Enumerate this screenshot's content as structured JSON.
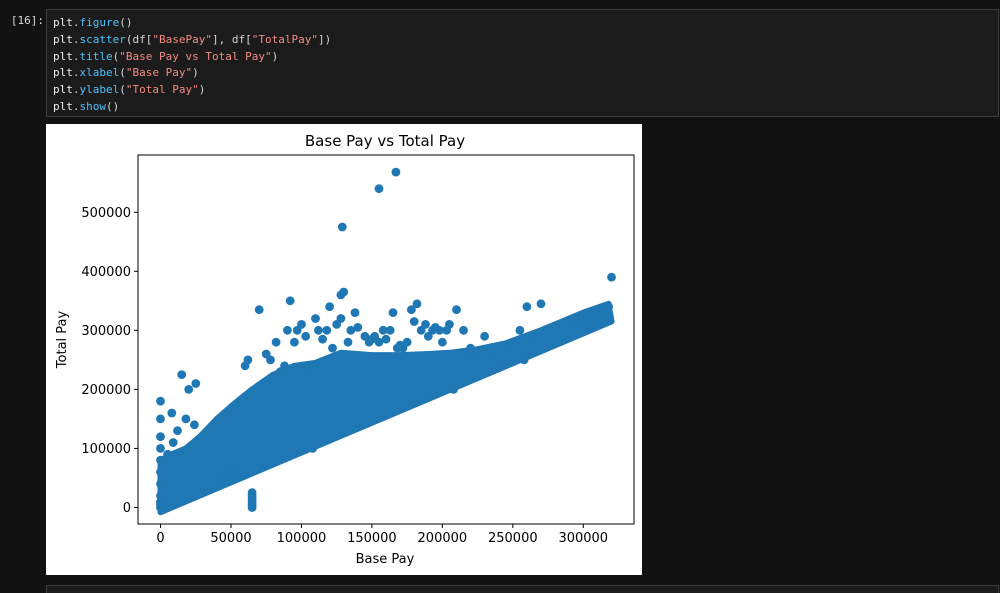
{
  "cell": {
    "prompt": "[16]:",
    "code_lines": [
      [
        {
          "t": "plt",
          "c": "plt"
        },
        {
          "t": ".",
          "c": "punct"
        },
        {
          "t": "figure",
          "c": "fn"
        },
        {
          "t": "()",
          "c": "punct"
        }
      ],
      [
        {
          "t": "plt",
          "c": "plt"
        },
        {
          "t": ".",
          "c": "punct"
        },
        {
          "t": "scatter",
          "c": "fn"
        },
        {
          "t": "(df[",
          "c": "punct"
        },
        {
          "t": "\"BasePay\"",
          "c": "str"
        },
        {
          "t": "], df[",
          "c": "punct"
        },
        {
          "t": "\"TotalPay\"",
          "c": "str"
        },
        {
          "t": "])",
          "c": "punct"
        }
      ],
      [
        {
          "t": "plt",
          "c": "plt"
        },
        {
          "t": ".",
          "c": "punct"
        },
        {
          "t": "title",
          "c": "fn"
        },
        {
          "t": "(",
          "c": "punct"
        },
        {
          "t": "\"Base Pay vs Total Pay\"",
          "c": "str"
        },
        {
          "t": ")",
          "c": "punct"
        }
      ],
      [
        {
          "t": "plt",
          "c": "plt"
        },
        {
          "t": ".",
          "c": "punct"
        },
        {
          "t": "xlabel",
          "c": "fn"
        },
        {
          "t": "(",
          "c": "punct"
        },
        {
          "t": "\"Base Pay\"",
          "c": "str"
        },
        {
          "t": ")",
          "c": "punct"
        }
      ],
      [
        {
          "t": "plt",
          "c": "plt"
        },
        {
          "t": ".",
          "c": "punct"
        },
        {
          "t": "ylabel",
          "c": "fn"
        },
        {
          "t": "(",
          "c": "punct"
        },
        {
          "t": "\"Total Pay\"",
          "c": "str"
        },
        {
          "t": ")",
          "c": "punct"
        }
      ],
      [
        {
          "t": "plt",
          "c": "plt"
        },
        {
          "t": ".",
          "c": "punct"
        },
        {
          "t": "show",
          "c": "fn"
        },
        {
          "t": "()",
          "c": "punct"
        }
      ]
    ]
  },
  "colors": {
    "point": "#1f77b4",
    "code_function": "#4fc1ff",
    "code_string": "#f38b84",
    "background": "#121212"
  },
  "chart_data": {
    "type": "scatter",
    "title": "Base Pay vs Total Pay",
    "xlabel": "Base Pay",
    "ylabel": "Total Pay",
    "xlim": [
      -16000,
      336000
    ],
    "ylim": [
      -28000,
      597000
    ],
    "xticks": [
      0,
      50000,
      100000,
      150000,
      200000,
      250000,
      300000
    ],
    "xtick_labels": [
      "0",
      "50000",
      "100000",
      "150000",
      "200000",
      "250000",
      "300000"
    ],
    "yticks": [
      0,
      100000,
      200000,
      300000,
      400000,
      500000
    ],
    "ytick_labels": [
      "0",
      "100000",
      "200000",
      "300000",
      "400000",
      "500000"
    ],
    "grid": false,
    "legend": false,
    "series": [
      {
        "x": [
          0,
          0,
          0,
          0,
          0,
          0,
          0,
          0,
          0,
          0,
          0,
          2000,
          3000,
          5000,
          8000,
          9000,
          12000,
          15000,
          18000,
          20000,
          24000,
          25000,
          10000,
          14000,
          28000,
          65000,
          65000,
          65000,
          65000,
          65000,
          65000,
          60000,
          62000,
          68000,
          70000,
          72000,
          75000,
          78000,
          82000,
          85000,
          90000,
          88000,
          92000,
          95000,
          97000,
          100000,
          103000,
          105000,
          110000,
          112000,
          115000,
          118000,
          120000,
          122000,
          125000,
          128000,
          130000,
          133000,
          135000,
          138000,
          140000,
          145000,
          148000,
          150000,
          152000,
          155000,
          158000,
          160000,
          163000,
          165000,
          168000,
          170000,
          172000,
          175000,
          178000,
          180000,
          182000,
          185000,
          188000,
          190000,
          193000,
          195000,
          198000,
          200000,
          203000,
          205000,
          210000,
          215000,
          220000,
          225000,
          230000,
          235000,
          240000,
          245000,
          250000,
          255000,
          260000,
          265000,
          268000,
          270000,
          275000,
          285000,
          292000,
          300000,
          305000,
          310000,
          313000,
          318000,
          320000,
          129000,
          155000,
          167000,
          128000,
          40000,
          45000,
          50000,
          55000,
          35000,
          30000,
          48000,
          58000,
          42000,
          52000,
          38000,
          80000,
          108000,
          140000,
          132000,
          162000,
          208000,
          186000,
          232000,
          258000,
          100000,
          150000,
          200000,
          250000,
          300000,
          180000,
          120000,
          160000,
          220000,
          280000
        ],
        "y": [
          180000,
          150000,
          120000,
          100000,
          80000,
          60000,
          40000,
          20000,
          10000,
          5000,
          0,
          5000,
          30000,
          90000,
          160000,
          110000,
          130000,
          225000,
          150000,
          200000,
          140000,
          210000,
          20000,
          60000,
          100000,
          0,
          5000,
          10000,
          15000,
          20000,
          25000,
          240000,
          250000,
          200000,
          335000,
          180000,
          260000,
          250000,
          280000,
          230000,
          300000,
          240000,
          350000,
          280000,
          300000,
          310000,
          290000,
          230000,
          320000,
          300000,
          285000,
          300000,
          340000,
          270000,
          310000,
          320000,
          365000,
          280000,
          300000,
          330000,
          305000,
          290000,
          280000,
          285000,
          290000,
          280000,
          300000,
          285000,
          300000,
          330000,
          270000,
          275000,
          270000,
          280000,
          335000,
          315000,
          345000,
          300000,
          310000,
          290000,
          300000,
          305000,
          300000,
          280000,
          300000,
          310000,
          335000,
          300000,
          270000,
          260000,
          290000,
          265000,
          255000,
          260000,
          280000,
          300000,
          340000,
          270000,
          285000,
          345000,
          300000,
          290000,
          310000,
          320000,
          315000,
          330000,
          320000,
          340000,
          390000,
          475000,
          540000,
          568000,
          360000,
          40000,
          50000,
          55000,
          60000,
          35000,
          30000,
          65000,
          70000,
          45000,
          62000,
          42000,
          90000,
          100000,
          140000,
          130000,
          160000,
          200000,
          190000,
          230000,
          250000,
          180000,
          230000,
          250000,
          270000,
          310000,
          240000,
          210000,
          220000,
          250000,
          285000
        ]
      }
    ]
  }
}
